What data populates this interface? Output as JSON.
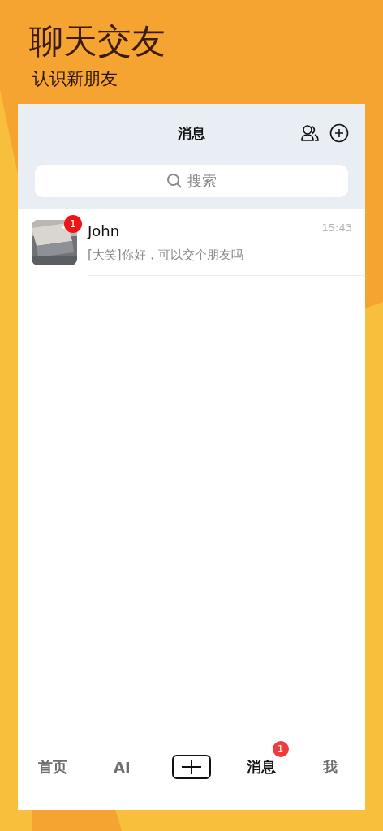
{
  "promo": {
    "title": "聊天交友",
    "subtitle": "认识新朋友"
  },
  "screen": {
    "title": "消息",
    "search": {
      "placeholder": "搜索"
    },
    "conversations": [
      {
        "name": "John",
        "time": "15:43",
        "preview": "[大笑]你好，可以交个朋友吗",
        "unread": "1"
      }
    ],
    "tab_bar": [
      {
        "kind": "text",
        "label": "首页",
        "selected": false
      },
      {
        "kind": "text",
        "label": "AI",
        "selected": false
      },
      {
        "kind": "add",
        "selected": false
      },
      {
        "kind": "text",
        "label": "消息",
        "selected": true,
        "badge": "1"
      },
      {
        "kind": "text",
        "label": "我",
        "selected": false
      }
    ]
  }
}
